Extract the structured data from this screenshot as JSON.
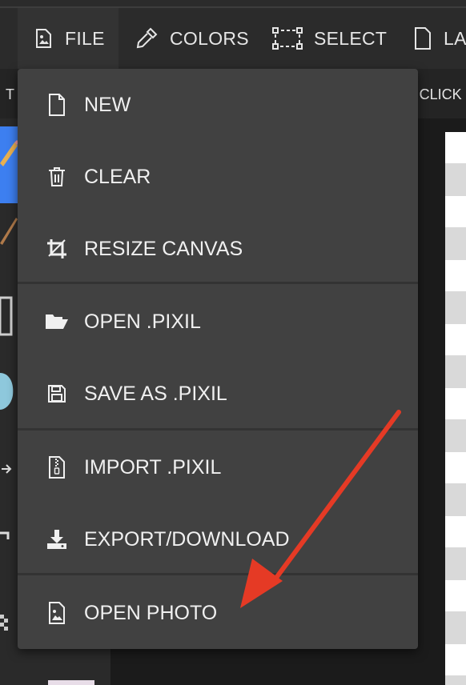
{
  "toolbar": {
    "tabs": [
      {
        "label": "FILE",
        "icon": "image-icon"
      },
      {
        "label": "COLORS",
        "icon": "eyedropper-icon"
      },
      {
        "label": "SELECT",
        "icon": "select-icon"
      },
      {
        "label": "LA",
        "icon": "file-icon"
      }
    ]
  },
  "subbar": {
    "left_text": "T",
    "right_text": "T CLICK"
  },
  "file_menu": {
    "items": [
      {
        "label": "NEW",
        "icon": "file-icon"
      },
      {
        "label": "CLEAR",
        "icon": "trash-icon"
      },
      {
        "label": "RESIZE CANVAS",
        "icon": "crop-icon"
      },
      {
        "label": "OPEN .PIXIL",
        "icon": "folder-open-icon"
      },
      {
        "label": "SAVE AS .PIXIL",
        "icon": "save-icon"
      },
      {
        "label": "IMPORT .PIXIL",
        "icon": "zip-file-icon"
      },
      {
        "label": "EXPORT/DOWNLOAD",
        "icon": "download-icon"
      },
      {
        "label": "OPEN PHOTO",
        "icon": "image-icon"
      }
    ]
  },
  "colors": {
    "annotation_arrow": "#e53a25",
    "menu_bg": "#414141",
    "topbar_bg": "#2b2b2b"
  }
}
